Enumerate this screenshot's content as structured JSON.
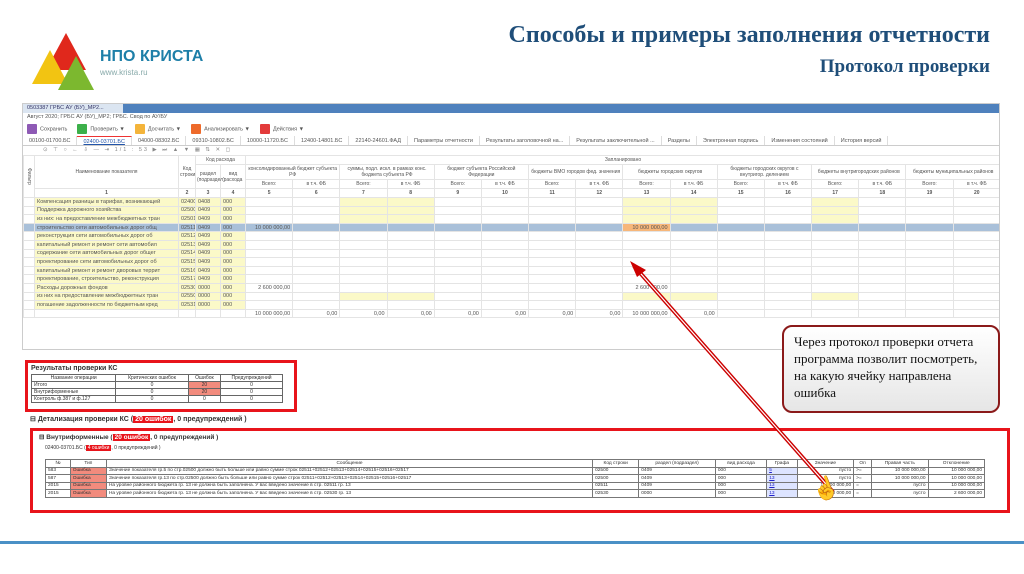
{
  "slide": {
    "title": "Способы и примеры заполнения отчетности",
    "subtitle": "Протокол проверки",
    "logo_name": "НПО КРИСТА",
    "logo_url": "www.krista.ru",
    "callout": "Через протокол проверки отчета программа позволит посмотреть, на какую ячейку направлена ошибка"
  },
  "app": {
    "doc_tab": "0503387 ГРБС АУ (БУ)_МР2...",
    "breadcrumb": "Август 2020; ГРБС АУ (БУ)_МР2; ГРБС. Свод по АУ/БУ",
    "toolbar": [
      "Сохранить",
      "Проверить ▼",
      "Досчитать ▼",
      "Анализировать ▼",
      "Действия ▼"
    ],
    "tabs": [
      "00100-01700.БС",
      "02400-03701.БС",
      "04000-08302.БС",
      "09310-10802.БС",
      "10000-11720.БС",
      "12400-14801.БС",
      "22140-24601.ФАД",
      "Параметры отчетности",
      "Результаты заголовочной на...",
      "Результаты заключительной ...",
      "Разделы",
      "Электронная подпись",
      "Изменения состояний",
      "История версий"
    ],
    "active_tab": 1,
    "nav": "⊙ ⊤ ○ ← ⇩ — ⇥ 1/1 : 53 ▶ ⏭ ▲ ▼ ▦ ⇅ ✕ ◻",
    "filter_label": "Фильтр",
    "headers": {
      "name": "Наименование показателя",
      "code": "Код строки",
      "expense": "Код расхода",
      "section": "раздел (подраздел)",
      "kind": "вид расхода",
      "planned": "Запланировано",
      "groups": [
        "консолидированный бюджет субъекта РФ",
        "суммы, подл. искл. в рамках конс. бюджета субъекта РФ",
        "бюджет субъекта Российской Федерации",
        "бюджеты ВМО городов фед. значения",
        "бюджеты городских округов",
        "бюджеты городских округов с внутригор. делением",
        "бюджеты внутригородских районов",
        "бюджеты муниципальных районов"
      ],
      "sub_total": "Всего:",
      "sub_fb": "в т.ч. ФБ",
      "col_numbers": [
        "1",
        "2",
        "3",
        "4",
        "5",
        "6",
        "7",
        "8",
        "9",
        "10",
        "11",
        "12",
        "13",
        "14",
        "15",
        "16",
        "17",
        "18",
        "19",
        "20"
      ]
    },
    "rows": [
      {
        "name": "Компенсация разницы в тарифах, возникающей",
        "code": "02400",
        "sec": "0408",
        "kind": "000",
        "v5": "",
        "v13": ""
      },
      {
        "name": "Поддержка дорожного хозяйства",
        "code": "02500",
        "sec": "0409",
        "kind": "000",
        "v5": "",
        "v13": ""
      },
      {
        "name": "из них: на предоставление межбюджетных тран",
        "code": "02501",
        "sec": "0409",
        "kind": "000",
        "v5": "",
        "v13": ""
      },
      {
        "name": "строительство сети автомобильных дорог общ",
        "code": "02511",
        "sec": "0409",
        "kind": "000",
        "v5": "10 000 000,00",
        "v13": "10 000 000,00",
        "selected": true
      },
      {
        "name": "реконструкция сети автомобильных дорог об",
        "code": "02512",
        "sec": "0409",
        "kind": "000",
        "v5": "",
        "v13": ""
      },
      {
        "name": "капитальный ремонт и ремонт сети автомобил",
        "code": "02513",
        "sec": "0409",
        "kind": "000",
        "v5": "",
        "v13": ""
      },
      {
        "name": "содержание сети автомобильных дорог общег",
        "code": "02514",
        "sec": "0409",
        "kind": "000",
        "v5": "",
        "v13": ""
      },
      {
        "name": "проектирование сети автомобильных дорог об",
        "code": "02515",
        "sec": "0409",
        "kind": "000",
        "v5": "",
        "v13": ""
      },
      {
        "name": "капитальный ремонт и ремонт дворовых террит",
        "code": "02516",
        "sec": "0409",
        "kind": "000",
        "v5": "",
        "v13": ""
      },
      {
        "name": "проектирование, строительство, реконструкция",
        "code": "02517",
        "sec": "0409",
        "kind": "000",
        "v5": "",
        "v13": ""
      },
      {
        "name": "Расходы дорожных фондов",
        "code": "02530",
        "sec": "0000",
        "kind": "000",
        "v5": "2 600 000,00",
        "v13": "2 600 000,00"
      },
      {
        "name": "из них на предоставление межбюджетных тран",
        "code": "02550",
        "sec": "0000",
        "kind": "000",
        "v5": "",
        "v13": ""
      },
      {
        "name": "погашение задолженности по бюджетным кред",
        "code": "02531",
        "sec": "0000",
        "kind": "000",
        "v5": "",
        "v13": ""
      }
    ],
    "totals": [
      "10 000 000,00",
      "0,00",
      "0,00",
      "0,00",
      "0,00",
      "0,00",
      "0,00",
      "0,00",
      "10 000 000,00",
      "0,00",
      "",
      "",
      "",
      "",
      "",
      ""
    ]
  },
  "results": {
    "title": "Результаты проверки КС",
    "headers": [
      "Название операции",
      "Критических ошибок",
      "Ошибок",
      "Предупреждений"
    ],
    "rows": [
      [
        "Итого",
        "0",
        "20",
        "0"
      ],
      [
        "Внутриформенные",
        "0",
        "20",
        "0"
      ],
      [
        "Контроль ф.387 и ф.127",
        "0",
        "0",
        "0"
      ]
    ]
  },
  "detail": {
    "heading_pre": "Детализация проверки КС (",
    "heading_err": "20 ошибок",
    "heading_post": ", 0 предупреждений )",
    "intra_pre": "Внутриформенные (",
    "intra_err": "20 ошибок",
    "intra_post": ", 0 предупреждений )",
    "form_pre": "02400-03701.БС (",
    "form_err": "4 ошибки",
    "form_post": ", 0 предупреждений )",
    "headers": [
      "№",
      "Тип",
      "Сообщение",
      "Код строки",
      "раздел (подраздел)",
      "вид расхода",
      "Графа",
      "Значение",
      "Оп",
      "Правая часть",
      "Отклонение"
    ],
    "rows": [
      [
        "583",
        "Ошибка",
        "Значение показателя гр.5 по стр.02500 должно быть больше или равно сумме строк 02511+02512+02513+02514+02515+02516+02517",
        "02500",
        "0409",
        "000",
        "5",
        "пусто",
        ">=",
        "10 000 000,00",
        "10 000 000,00"
      ],
      [
        "587",
        "Ошибка",
        "Значение показателя гр.13 по стр.02500 должно быть больше или равно сумме строк 02511+02512+02513+02514+02515+02516+02517",
        "02500",
        "0409",
        "000",
        "13",
        "пусто",
        ">=",
        "10 000 000,00",
        "10 000 000,00"
      ],
      [
        "2015",
        "Ошибка",
        "На уровне районного бюджета гр. 13 не должна быть заполнена. У вас введено значение в стр. 02511 гр. 13",
        "02511",
        "0409",
        "000",
        "13",
        "10 000 000,00",
        "=",
        "пусто",
        "10 000 000,00"
      ],
      [
        "2015",
        "Ошибка",
        "На уровне районного бюджета гр. 13 не должна быть заполнена. У вас введено значение в стр. 02530 гр. 13",
        "02530",
        "0000",
        "000",
        "13",
        "2 600 000,00",
        "=",
        "пусто",
        "2 600 000,00"
      ]
    ]
  },
  "colors": {
    "title": "#1f4e79",
    "error_red": "#e8141b",
    "error_cell": "#f28b7d",
    "selected_row": "#a9c0d9",
    "highlight_cell": "#f7b77a"
  }
}
